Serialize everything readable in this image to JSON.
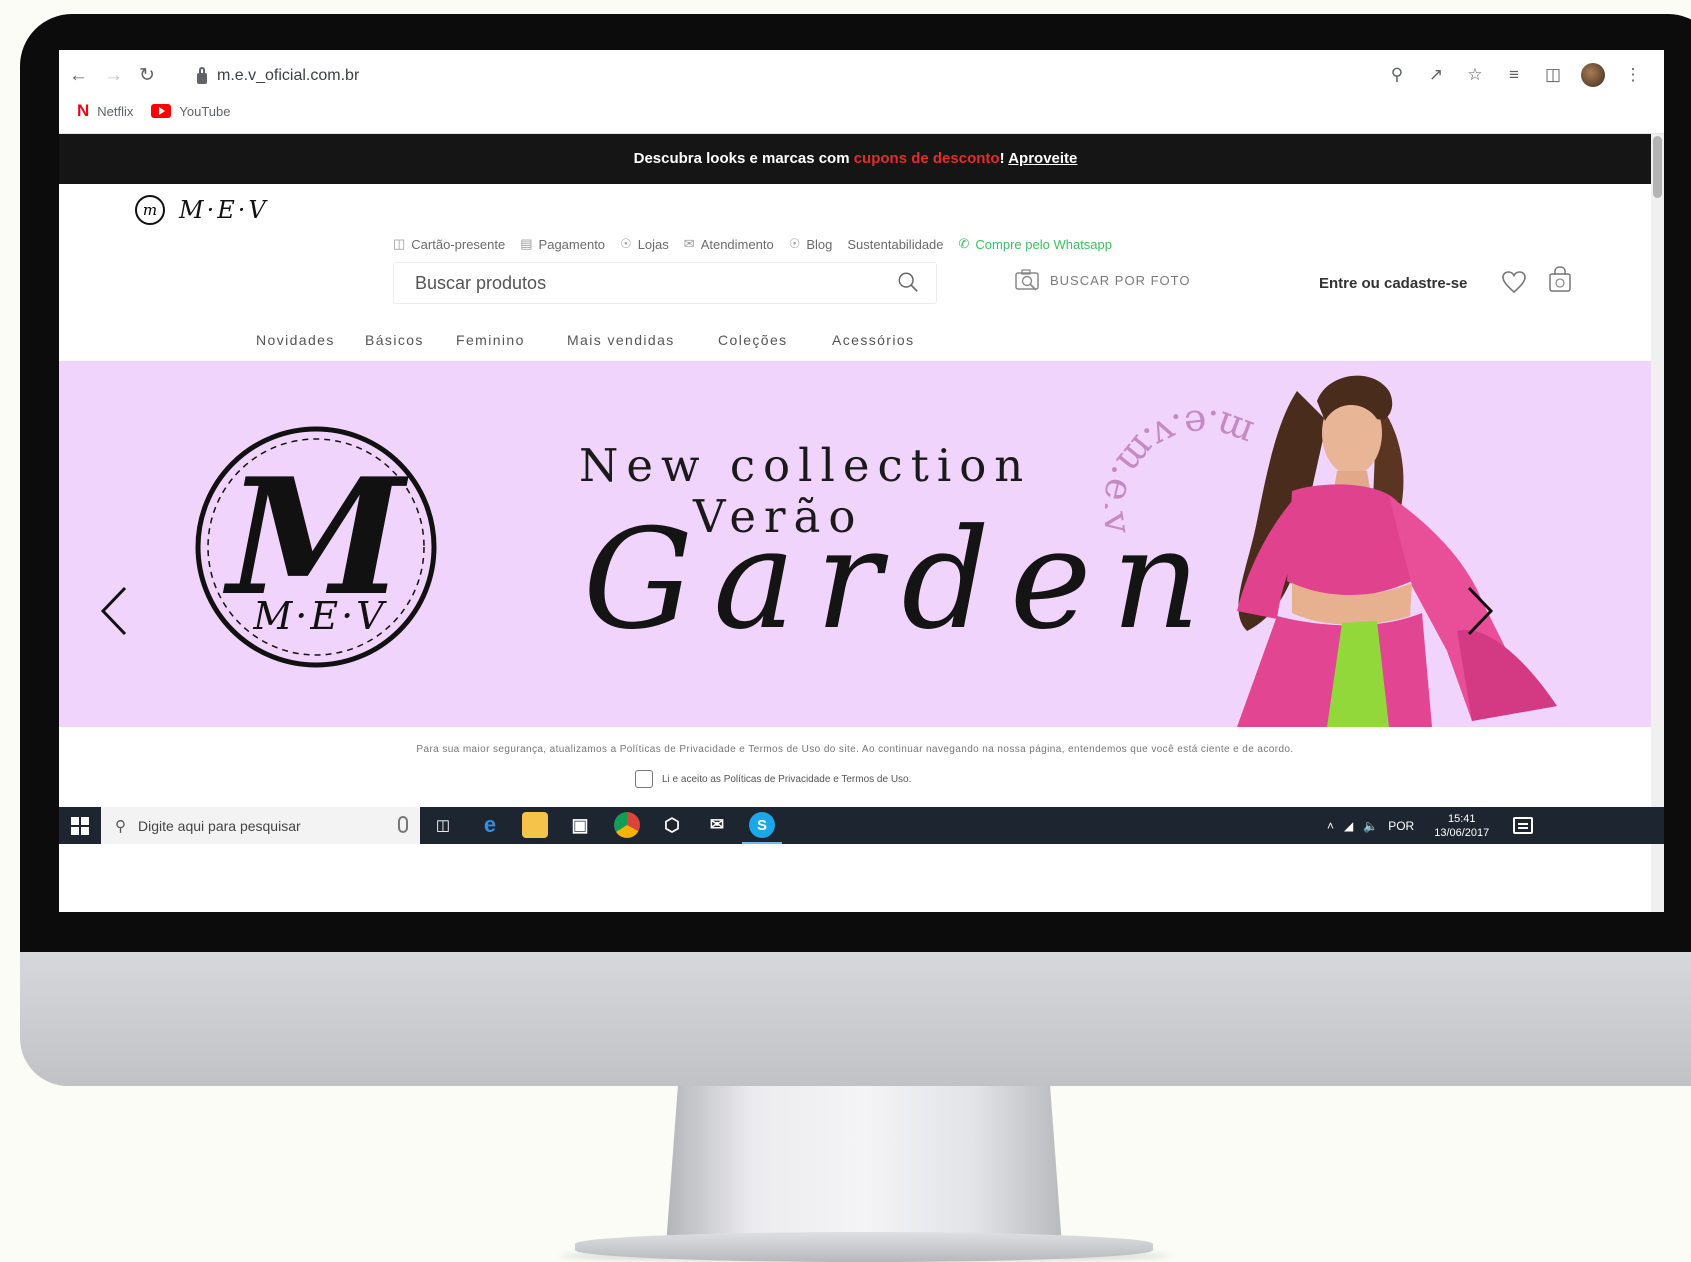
{
  "browser": {
    "url": "m.e.v_oficial.com.br",
    "bookmarks": [
      {
        "label": "Netflix",
        "icon": "netflix-icon"
      },
      {
        "label": "YouTube",
        "icon": "youtube-icon"
      }
    ]
  },
  "promo": {
    "text_before": "Descubra looks e marcas com ",
    "highlight": "cupons de desconto",
    "exclaim": "!",
    "link": "Aproveite",
    "highlight_color": "#e52b2b"
  },
  "site": {
    "logo_badge": "m",
    "logo_text": "M·E·V",
    "util_links": [
      {
        "label": "Cartão-presente",
        "icon": "gift-icon"
      },
      {
        "label": "Pagamento",
        "icon": "card-icon"
      },
      {
        "label": "Lojas",
        "icon": "store-pin-icon"
      },
      {
        "label": "Atendimento",
        "icon": "chat-icon"
      },
      {
        "label": "Blog",
        "icon": "blog-icon"
      },
      {
        "label": "Sustentabilidade",
        "icon": ""
      },
      {
        "label": "Compre pelo Whatsapp",
        "icon": "whatsapp-icon"
      }
    ],
    "search_placeholder": "Buscar produtos",
    "photo_search": "BUSCAR POR FOTO",
    "login": "Entre ou cadastre-se",
    "categories": [
      "Novidades",
      "Básicos",
      "Feminino",
      "Mais vendidas",
      "Coleções",
      "Acessórios"
    ]
  },
  "hero": {
    "line1": "New collection",
    "line2": "Verão",
    "line3": "Garden",
    "logo_letter": "M",
    "logo_sub": "M·E·V",
    "circle_text": "m.e.v.m.e.v",
    "background": "#f0d4fb",
    "outfit_color": "#e0428e",
    "accent_green": "#92d83a"
  },
  "cookie": {
    "notice": "Para sua maior segurança, atualizamos a Políticas de Privacidade e Termos de Uso do site. Ao continuar navegando na nossa página, entendemos que você está ciente e de acordo.",
    "checkbox_label": "Li e aceito as Políticas de Privacidade e Termos de Uso."
  },
  "taskbar": {
    "search_placeholder": "Digite aqui para pesquisar",
    "language": "POR",
    "time": "15:41",
    "date": "13/06/2017"
  }
}
